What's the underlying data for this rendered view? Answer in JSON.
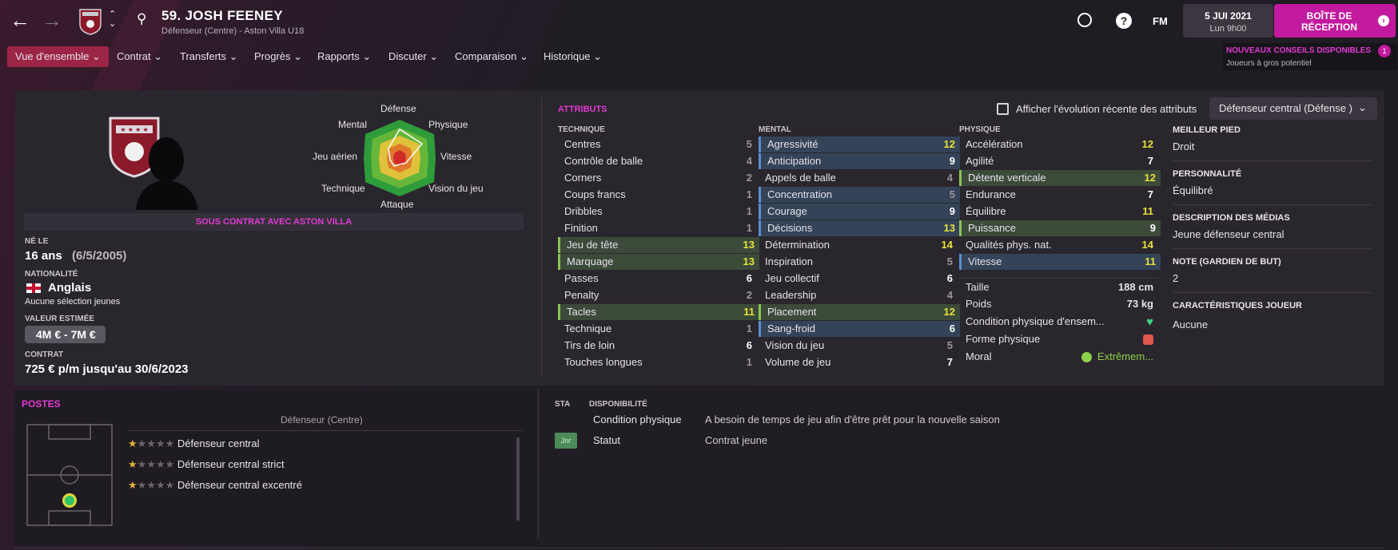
{
  "header": {
    "title": "59. JOSH FEENEY",
    "subtitle": "Défenseur (Centre) - Aston Villa U18",
    "fm_label": "FM",
    "date": "5 JUI 2021",
    "time": "Lun 9h00",
    "inbox_label": "BOÎTE DE RÉCEPTION"
  },
  "menu": [
    {
      "label": "Vue d'ensemble"
    },
    {
      "label": "Contrat"
    },
    {
      "label": "Transferts"
    },
    {
      "label": "Progrès"
    },
    {
      "label": "Rapports"
    },
    {
      "label": "Discuter"
    },
    {
      "label": "Comparaison"
    },
    {
      "label": "Historique"
    }
  ],
  "notification": {
    "title": "NOUVEAUX CONSEILS DISPONIBLES",
    "text": "Joueurs à gros potentiel",
    "count": "1"
  },
  "radar": {
    "labels": {
      "top": "Défense",
      "tr": "Physique",
      "r": "Vitesse",
      "br": "Vision du jeu",
      "bottom": "Attaque",
      "bl": "Technique",
      "l": "Jeu aérien",
      "tl": "Mental"
    }
  },
  "profile": {
    "contract_banner": "SOUS CONTRAT AVEC ASTON VILLA",
    "born_label": "NÉ LE",
    "age": "16 ans",
    "dob": "(6/5/2005)",
    "nationality_label": "NATIONALITÉ",
    "nationality": "Anglais",
    "caps": "Aucune sélection jeunes",
    "value_label": "VALEUR ESTIMÉE",
    "value": "4M € - 7M €",
    "contract_label": "CONTRAT",
    "contract": "725 € p/m jusqu'au 30/6/2023"
  },
  "attributes": {
    "title": "ATTRIBUTS",
    "toggle_label": "Afficher l'évolution récente des attributs",
    "role_select": "Défenseur central (Défense )",
    "technique_title": "TECHNIQUE",
    "mental_title": "MENTAL",
    "physique_title": "PHYSIQUE",
    "technique": [
      {
        "name": "Centres",
        "value": "5",
        "hl": ""
      },
      {
        "name": "Contrôle de balle",
        "value": "4",
        "hl": ""
      },
      {
        "name": "Corners",
        "value": "2",
        "hl": ""
      },
      {
        "name": "Coups francs",
        "value": "1",
        "hl": ""
      },
      {
        "name": "Dribbles",
        "value": "1",
        "hl": ""
      },
      {
        "name": "Finition",
        "value": "1",
        "hl": ""
      },
      {
        "name": "Jeu de tête",
        "value": "13",
        "hl": "green"
      },
      {
        "name": "Marquage",
        "value": "13",
        "hl": "green"
      },
      {
        "name": "Passes",
        "value": "6",
        "hl": ""
      },
      {
        "name": "Penalty",
        "value": "2",
        "hl": ""
      },
      {
        "name": "Tacles",
        "value": "11",
        "hl": "green"
      },
      {
        "name": "Technique",
        "value": "1",
        "hl": ""
      },
      {
        "name": "Tirs de loin",
        "value": "6",
        "hl": ""
      },
      {
        "name": "Touches longues",
        "value": "1",
        "hl": ""
      }
    ],
    "mental": [
      {
        "name": "Agressivité",
        "value": "12",
        "hl": "blue"
      },
      {
        "name": "Anticipation",
        "value": "9",
        "hl": "blue"
      },
      {
        "name": "Appels de balle",
        "value": "4",
        "hl": ""
      },
      {
        "name": "Concentration",
        "value": "5",
        "hl": "blue"
      },
      {
        "name": "Courage",
        "value": "9",
        "hl": "blue"
      },
      {
        "name": "Décisions",
        "value": "13",
        "hl": "blue"
      },
      {
        "name": "Détermination",
        "value": "14",
        "hl": ""
      },
      {
        "name": "Inspiration",
        "value": "5",
        "hl": ""
      },
      {
        "name": "Jeu collectif",
        "value": "6",
        "hl": ""
      },
      {
        "name": "Leadership",
        "value": "4",
        "hl": ""
      },
      {
        "name": "Placement",
        "value": "12",
        "hl": "green"
      },
      {
        "name": "Sang-froid",
        "value": "6",
        "hl": "blue"
      },
      {
        "name": "Vision du jeu",
        "value": "5",
        "hl": ""
      },
      {
        "name": "Volume de jeu",
        "value": "7",
        "hl": ""
      }
    ],
    "physique": [
      {
        "name": "Accélération",
        "value": "12",
        "hl": ""
      },
      {
        "name": "Agilité",
        "value": "7",
        "hl": ""
      },
      {
        "name": "Détente verticale",
        "value": "12",
        "hl": "green"
      },
      {
        "name": "Endurance",
        "value": "7",
        "hl": ""
      },
      {
        "name": "Équilibre",
        "value": "11",
        "hl": ""
      },
      {
        "name": "Puissance",
        "value": "9",
        "hl": "green"
      },
      {
        "name": "Qualités phys. nat.",
        "value": "14",
        "hl": ""
      },
      {
        "name": "Vitesse",
        "value": "11",
        "hl": "blue"
      }
    ],
    "misc": [
      {
        "name": "Taille",
        "value": "188 cm"
      },
      {
        "name": "Poids",
        "value": "73 kg"
      },
      {
        "name": "Condition physique d'ensem...",
        "value": ""
      },
      {
        "name": "Forme physique",
        "value": ""
      },
      {
        "name": "Moral",
        "value": "Extrêmem..."
      }
    ]
  },
  "side": {
    "foot_label": "MEILLEUR PIED",
    "foot": "Droit",
    "personality_label": "PERSONNALITÉ",
    "personality": "Équilibré",
    "media_label": "DESCRIPTION DES MÉDIAS",
    "media": "Jeune défenseur central",
    "gk_label": "NOTE (GARDIEN DE BUT)",
    "gk": "2",
    "traits_label": "CARACTÉRISTIQUES JOUEUR",
    "traits": "Aucune"
  },
  "positions": {
    "title": "POSTES",
    "main": "Défenseur (Centre)",
    "roles": [
      {
        "label": "Défenseur central",
        "stars": 1
      },
      {
        "label": "Défenseur central strict",
        "stars": 1
      },
      {
        "label": "Défenseur central excentré",
        "stars": 1
      }
    ]
  },
  "status": {
    "sta_label": "STA",
    "dispo_label": "DISPONIBILITÉ",
    "rows": [
      {
        "badge": "",
        "name": "Condition physique",
        "text": "A besoin de temps de jeu afin d'être prêt pour la nouvelle saison"
      },
      {
        "badge": "Jnr",
        "name": "Statut",
        "text": "Contrat jeune"
      }
    ]
  },
  "colors": {
    "accent": "#e23ad2",
    "inbox": "#c21a9e",
    "active_tab": "#9c2545",
    "value_yellow": "#e8e23a"
  }
}
